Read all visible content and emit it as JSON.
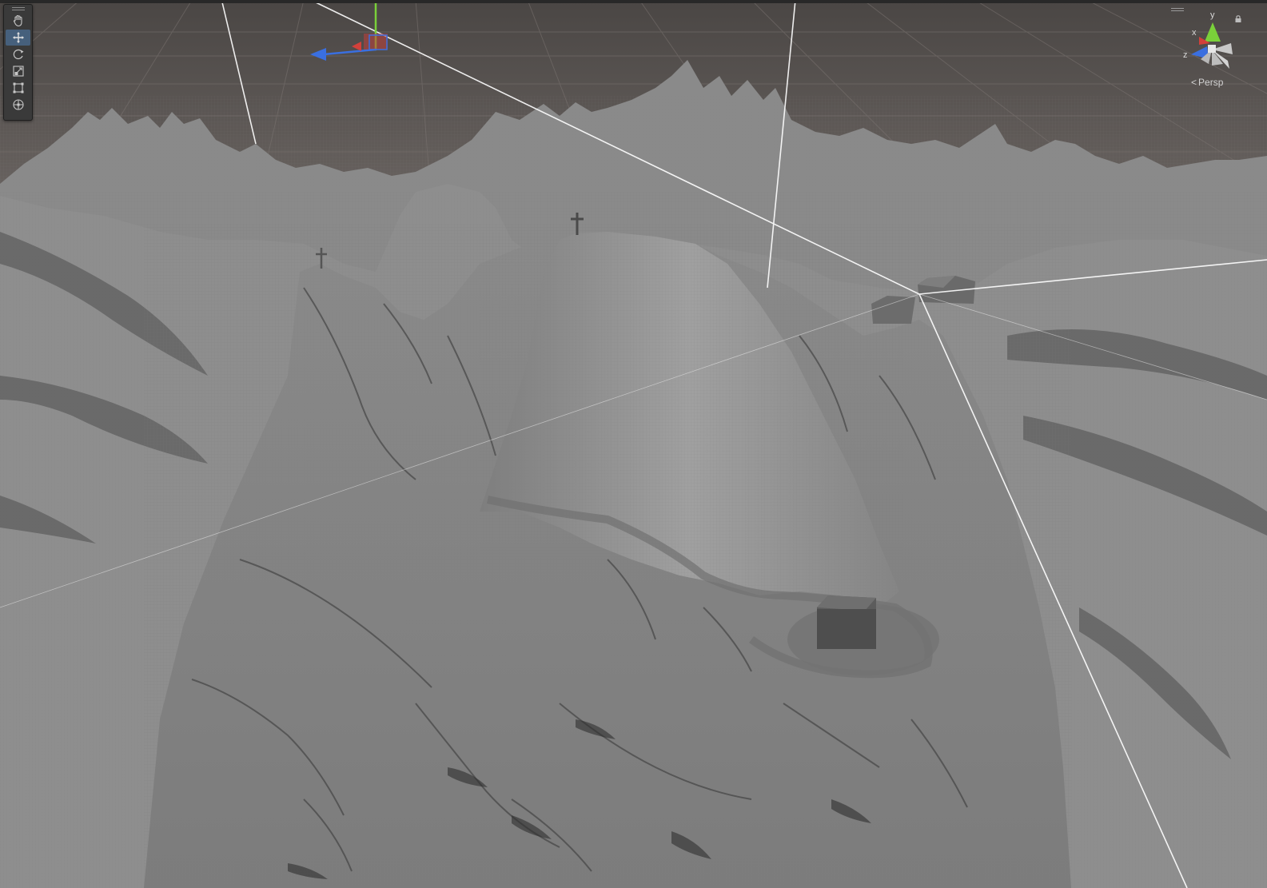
{
  "scene_view": {
    "camera_mode_label": "Persp",
    "gizmo_axes": {
      "x": "x",
      "y": "y",
      "z": "z"
    },
    "colors": {
      "axis_x": "#d2403a",
      "axis_y": "#7ad03a",
      "axis_z": "#3a6fe0",
      "terrain": "#8f8f8f",
      "ground": "#5e5a58",
      "toolbar_bg": "#3a3a3a",
      "toolbar_active": "#46607c"
    }
  },
  "toolbar": {
    "tools": [
      {
        "name": "hand-tool",
        "icon": "hand-icon"
      },
      {
        "name": "move-tool",
        "icon": "move-icon",
        "active": true
      },
      {
        "name": "rotate-tool",
        "icon": "rotate-icon"
      },
      {
        "name": "scale-tool",
        "icon": "scale-icon"
      },
      {
        "name": "rect-tool",
        "icon": "rect-transform-icon"
      },
      {
        "name": "transform-tool",
        "icon": "transform-icon"
      }
    ]
  }
}
